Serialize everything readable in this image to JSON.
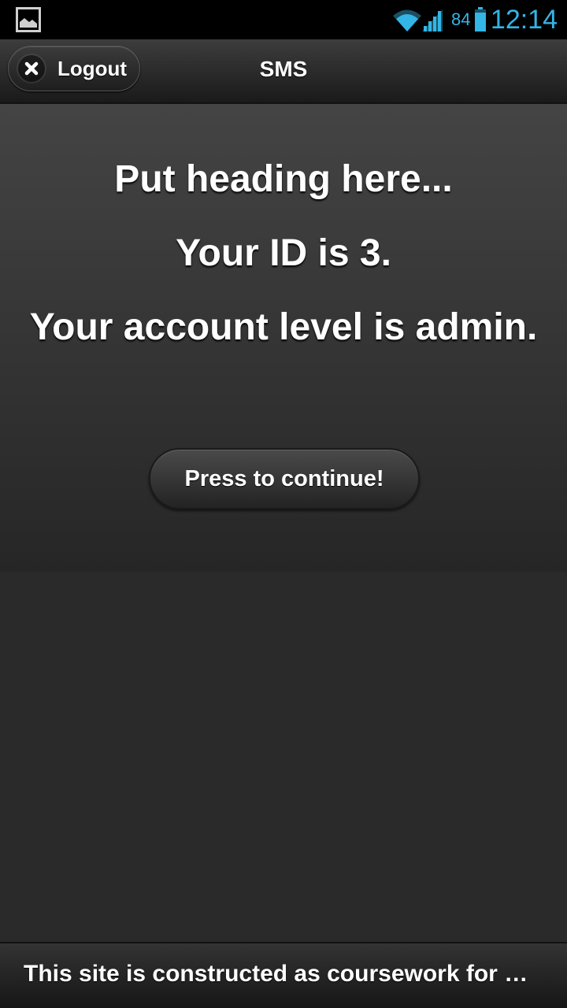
{
  "status_bar": {
    "battery_level": "84",
    "time": "12:14",
    "icons": [
      "gallery-icon",
      "wifi-icon",
      "signal-icon",
      "battery-icon"
    ],
    "accent_color": "#33b5e5"
  },
  "header": {
    "logout_label": "Logout",
    "title": "SMS"
  },
  "main": {
    "heading": "Put heading here...",
    "id_text": "Your ID is 3.",
    "level_text": "Your account level is admin.",
    "continue_label": "Press to continue!"
  },
  "footer": {
    "text": "This site is constructed as coursework for O..."
  }
}
